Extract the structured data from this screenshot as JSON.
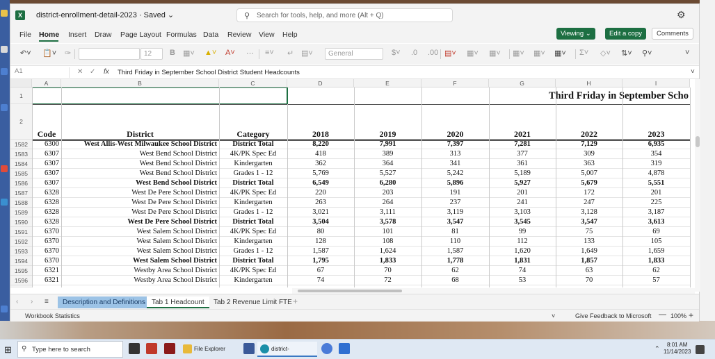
{
  "window": {
    "doc_title": "district-enrollment-detail-2023 · Saved ⌄",
    "search_placeholder": "Search for tools, help, and more (Alt + Q)"
  },
  "menu": {
    "items": [
      "File",
      "Home",
      "Insert",
      "Draw",
      "Page Layout",
      "Formulas",
      "Data",
      "Review",
      "View",
      "Help"
    ],
    "active": "Home",
    "viewing": "Viewing ⌄",
    "edit_copy": "Edit a copy",
    "comments": "Comments"
  },
  "ribbon": {
    "font_size": "12",
    "number_format": "General"
  },
  "formula_bar": {
    "name_box": "A1",
    "fx": "fx",
    "content": "Third Friday in September School District Student Headcounts"
  },
  "sheet": {
    "columns": [
      "A",
      "B",
      "C",
      "D",
      "E",
      "F",
      "G",
      "H",
      "I"
    ],
    "row1_title": "Third Friday in September Scho",
    "headers": [
      "Code",
      "District",
      "Category",
      "2018",
      "2019",
      "2020",
      "2021",
      "2022",
      "2023"
    ],
    "rows": [
      {
        "n": "1582",
        "code": "6300",
        "district": "West Allis-West Milwaukee School District",
        "cat": "District Total",
        "v": [
          "8,220",
          "7,991",
          "7,397",
          "7,281",
          "7,129",
          "6,935"
        ],
        "bold": true
      },
      {
        "n": "1583",
        "code": "6307",
        "district": "West Bend School District",
        "cat": "4K/PK Spec Ed",
        "v": [
          "418",
          "389",
          "313",
          "377",
          "309",
          "354"
        ],
        "bold": false
      },
      {
        "n": "1584",
        "code": "6307",
        "district": "West Bend School District",
        "cat": "Kindergarten",
        "v": [
          "362",
          "364",
          "341",
          "361",
          "363",
          "319"
        ],
        "bold": false
      },
      {
        "n": "1585",
        "code": "6307",
        "district": "West Bend School District",
        "cat": "Grades 1 - 12",
        "v": [
          "5,769",
          "5,527",
          "5,242",
          "5,189",
          "5,007",
          "4,878"
        ],
        "bold": false
      },
      {
        "n": "1586",
        "code": "6307",
        "district": "West Bend School District",
        "cat": "District Total",
        "v": [
          "6,549",
          "6,280",
          "5,896",
          "5,927",
          "5,679",
          "5,551"
        ],
        "bold": true
      },
      {
        "n": "1587",
        "code": "6328",
        "district": "West De Pere School District",
        "cat": "4K/PK Spec Ed",
        "v": [
          "220",
          "203",
          "191",
          "201",
          "172",
          "201"
        ],
        "bold": false
      },
      {
        "n": "1588",
        "code": "6328",
        "district": "West De Pere School District",
        "cat": "Kindergarten",
        "v": [
          "263",
          "264",
          "237",
          "241",
          "247",
          "225"
        ],
        "bold": false
      },
      {
        "n": "1589",
        "code": "6328",
        "district": "West De Pere School District",
        "cat": "Grades 1 - 12",
        "v": [
          "3,021",
          "3,111",
          "3,119",
          "3,103",
          "3,128",
          "3,187"
        ],
        "bold": false
      },
      {
        "n": "1590",
        "code": "6328",
        "district": "West De Pere School District",
        "cat": "District Total",
        "v": [
          "3,504",
          "3,578",
          "3,547",
          "3,545",
          "3,547",
          "3,613"
        ],
        "bold": true
      },
      {
        "n": "1591",
        "code": "6370",
        "district": "West Salem School District",
        "cat": "4K/PK Spec Ed",
        "v": [
          "80",
          "101",
          "81",
          "99",
          "75",
          "69"
        ],
        "bold": false
      },
      {
        "n": "1592",
        "code": "6370",
        "district": "West Salem School District",
        "cat": "Kindergarten",
        "v": [
          "128",
          "108",
          "110",
          "112",
          "133",
          "105"
        ],
        "bold": false
      },
      {
        "n": "1593",
        "code": "6370",
        "district": "West Salem School District",
        "cat": "Grades 1 - 12",
        "v": [
          "1,587",
          "1,624",
          "1,587",
          "1,620",
          "1,649",
          "1,659"
        ],
        "bold": false
      },
      {
        "n": "1594",
        "code": "6370",
        "district": "West Salem School District",
        "cat": "District Total",
        "v": [
          "1,795",
          "1,833",
          "1,778",
          "1,831",
          "1,857",
          "1,833"
        ],
        "bold": true
      },
      {
        "n": "1595",
        "code": "6321",
        "district": "Westby Area School District",
        "cat": "4K/PK Spec Ed",
        "v": [
          "67",
          "70",
          "62",
          "74",
          "63",
          "62"
        ],
        "bold": false
      },
      {
        "n": "1596",
        "code": "6321",
        "district": "Westby Area School District",
        "cat": "Kindergarten",
        "v": [
          "74",
          "72",
          "68",
          "53",
          "70",
          "57"
        ],
        "bold": false
      }
    ]
  },
  "tabs": [
    "Description and Definitions",
    "Tab 1 Headcount",
    "Tab 2 Revenue Limit FTE"
  ],
  "status": {
    "left": "Workbook Statistics",
    "feedback": "Give Feedback to Microsoft",
    "zoom": "100%"
  },
  "taskbar": {
    "search": "Type here to search",
    "file_explorer": "File Explorer",
    "edge_tab": "district-enrollment...",
    "time": "8:01 AM",
    "date": "11/14/2023"
  }
}
